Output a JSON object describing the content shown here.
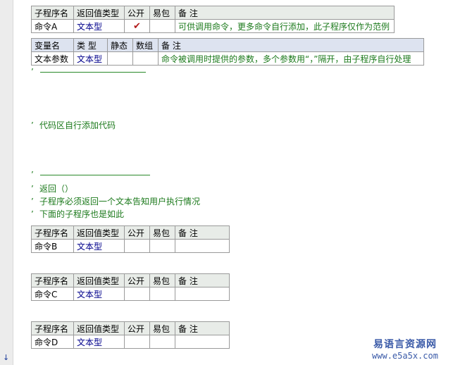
{
  "header_cols": [
    "子程序名",
    "返回值类型",
    "公开",
    "易包",
    "备 注"
  ],
  "var_cols": [
    "变量名",
    "类 型",
    "静态",
    "数组",
    "备 注"
  ],
  "sub_a": {
    "name": "命令A",
    "type": "文本型",
    "public_mark": "✔",
    "note": "可供调用命令，更多命令自行添加，此子程序仅作为范例"
  },
  "param": {
    "name": "文本参数",
    "type": "文本型",
    "note": "命令被调用时提供的参数，多个参数用“，”隔开，由子程序自行处理"
  },
  "comments": {
    "apostrophe": "’",
    "code_area": "代码区自行添加代码",
    "return": "返回（）",
    "must_return": "子程序必须返回一个文本告知用户执行情况",
    "below_also": "下面的子程序也是如此"
  },
  "sub_b": {
    "name": "命令B",
    "type": "文本型"
  },
  "sub_c": {
    "name": "命令C",
    "type": "文本型"
  },
  "sub_d": {
    "name": "命令D",
    "type": "文本型"
  },
  "watermark": {
    "cn": "易语言资源网",
    "en": "www.e5a5x.com"
  },
  "colors": {
    "type_text": "#00008b",
    "comment": "#1c7a1c",
    "check": "#b01818"
  },
  "icons": {
    "gutter_arrow": "down-arrow-icon"
  }
}
